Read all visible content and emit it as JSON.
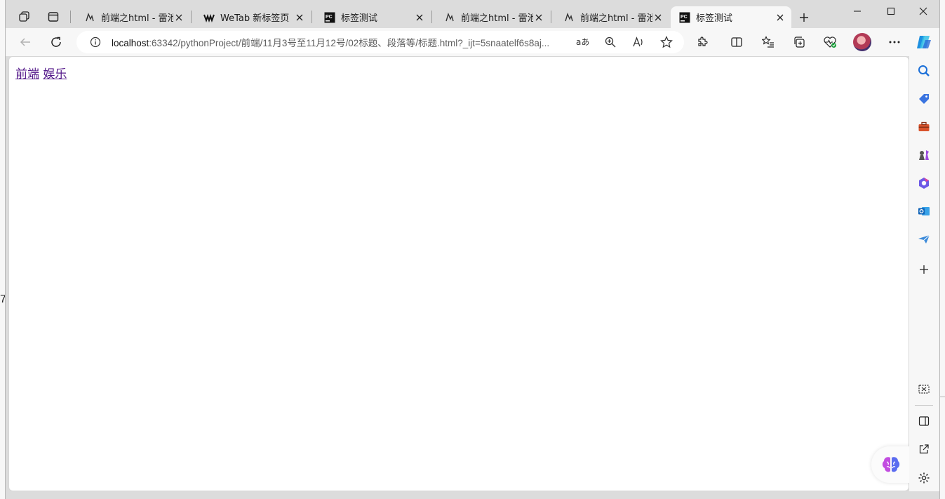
{
  "tabs": [
    {
      "title": "前端之html - 雷池码",
      "favicon": "mountain-logo-icon",
      "active": false
    },
    {
      "title": "WeTab 新标签页",
      "favicon": "wetab-logo-icon",
      "active": false
    },
    {
      "title": "标签测试",
      "favicon": "pycharm-logo-icon",
      "active": false
    },
    {
      "title": "前端之html - 雷池码",
      "favicon": "mountain-logo-icon",
      "active": false
    },
    {
      "title": "前端之html - 雷池码",
      "favicon": "mountain-logo-icon",
      "active": false
    },
    {
      "title": "标签测试",
      "favicon": "pycharm-logo-icon",
      "active": true
    }
  ],
  "address": {
    "host": "localhost",
    "path": ":63342/pythonProject/前端/11月3号至11月12号/02标题、段落等/标题.html?_ijt=5snaatelf6s8aj..."
  },
  "page": {
    "link1": "前端",
    "link2": "娱乐"
  },
  "edge_text": "7",
  "colors": {
    "visited_link": "#551a8b",
    "tabbar_bg": "#dcdcdc",
    "toolbar_bg": "#f7f7f7",
    "accent": "#0078d4"
  }
}
